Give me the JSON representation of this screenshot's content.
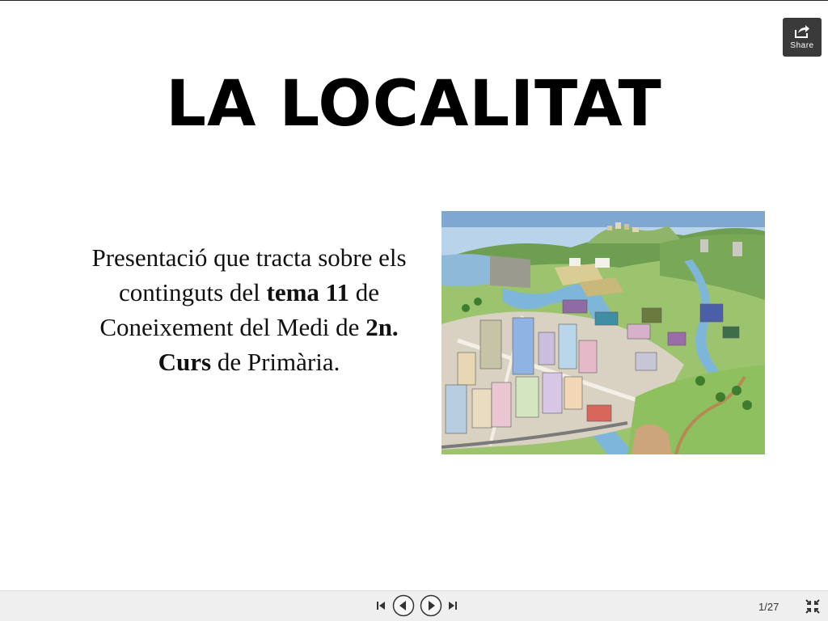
{
  "slide": {
    "title": "LA LOCALITAT",
    "body": {
      "part1": "Presentació que tracta sobre els continguts del ",
      "bold1": "tema 11",
      "part2": " de Coneixement del Medi de ",
      "bold2": "2n. Curs",
      "part3": " de Primària."
    },
    "illustration_icon": "town-illustration"
  },
  "toolbar": {
    "share_label": "Share",
    "share_icon": "share-icon",
    "first_icon": "skip-first-icon",
    "prev_icon": "previous-icon",
    "next_icon": "next-icon",
    "last_icon": "skip-last-icon",
    "fullscreen_icon": "exit-fullscreen-icon",
    "page_counter": "1/27"
  },
  "colors": {
    "share_bg": "#3a3a3a",
    "controls_bg": "#efefef",
    "control_stroke": "#333333"
  }
}
